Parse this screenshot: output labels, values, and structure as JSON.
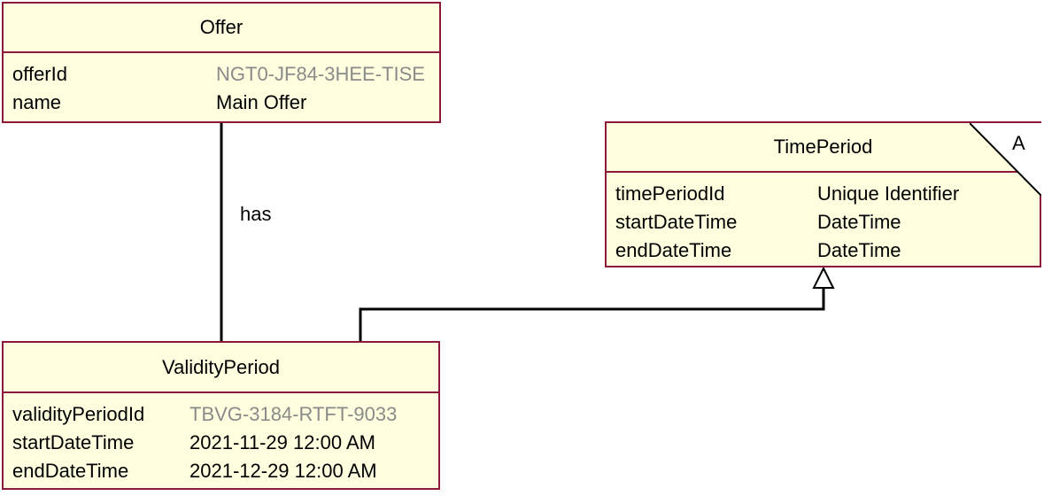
{
  "offer": {
    "title": "Offer",
    "attributes": [
      {
        "name": "offerId",
        "value": "NGT0-JF84-3HEE-TISE",
        "muted": true
      },
      {
        "name": "name",
        "value": "Main Offer",
        "muted": false
      }
    ]
  },
  "time_period": {
    "title": "TimePeriod",
    "abstract_marker": "A",
    "attributes": [
      {
        "name": "timePeriodId",
        "value": "Unique Identifier",
        "muted": false
      },
      {
        "name": "startDateTime",
        "value": "DateTime",
        "muted": false
      },
      {
        "name": "endDateTime",
        "value": "DateTime",
        "muted": false
      }
    ]
  },
  "validity_period": {
    "title": "ValidityPeriod",
    "attributes": [
      {
        "name": "validityPeriodId",
        "value": "TBVG-3184-RTFT-9033",
        "muted": true
      },
      {
        "name": "startDateTime",
        "value": "2021-11-29 12:00 AM",
        "muted": false
      },
      {
        "name": "endDateTime",
        "value": "2021-12-29 12:00 AM",
        "muted": false
      }
    ]
  },
  "association": {
    "label": "has"
  },
  "colors": {
    "box_fill": "#ffffe0",
    "box_border": "#8b1a3a",
    "muted_text": "#8a8a8a"
  }
}
